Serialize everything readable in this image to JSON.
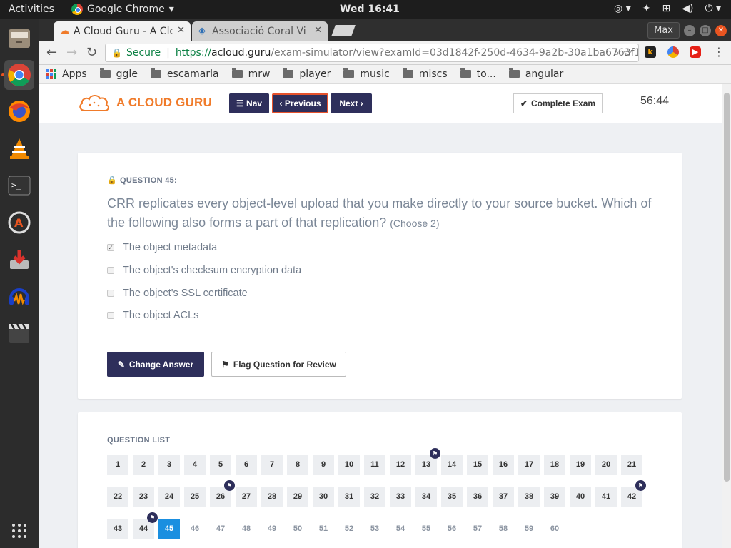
{
  "system": {
    "activities": "Activities",
    "app_name": "Google Chrome",
    "clock": "Wed 16:41"
  },
  "browser": {
    "tabs": [
      {
        "label": "A Cloud Guru - A Cloud Guru",
        "active": true
      },
      {
        "label": "Associació Coral Vi",
        "active": false
      }
    ],
    "window_label": "Max",
    "address": {
      "secure_label": "Secure",
      "scheme": "https://",
      "host": "acloud.guru",
      "path": "/exam-simulator/view?examId=03d1842f-250d-4634-9a2b-30a1ba6763f1..."
    },
    "bookmarks": [
      {
        "label": "Apps",
        "type": "apps"
      },
      {
        "label": "ggle",
        "type": "folder"
      },
      {
        "label": "escamarla",
        "type": "folder"
      },
      {
        "label": "mrw",
        "type": "folder"
      },
      {
        "label": "player",
        "type": "folder"
      },
      {
        "label": "music",
        "type": "folder"
      },
      {
        "label": "miscs",
        "type": "folder"
      },
      {
        "label": "to...",
        "type": "folder"
      },
      {
        "label": "angular",
        "type": "folder"
      }
    ]
  },
  "header": {
    "logo_text": "A CLOUD GURU",
    "nav_label": "Nav",
    "previous_label": "Previous",
    "next_label": "Next",
    "complete_label": "Complete Exam",
    "timer": "56:44"
  },
  "question": {
    "label": "QUESTION 45:",
    "text": "CRR replicates every object-level upload that you make directly to your source bucket. Which of the following also forms a part of that replication?",
    "choose": "(Choose 2)",
    "options": [
      {
        "label": "The object metadata",
        "checked": true
      },
      {
        "label": "The object's checksum encryption data",
        "checked": false
      },
      {
        "label": "The object's SSL certificate",
        "checked": false
      },
      {
        "label": "The object ACLs",
        "checked": false
      }
    ],
    "change_answer_label": "Change Answer",
    "flag_label": "Flag Question for Review"
  },
  "question_list": {
    "title": "QUESTION LIST",
    "total": 60,
    "current": 45,
    "answered_through": 44,
    "flagged": [
      13,
      26,
      42,
      44
    ]
  },
  "colors": {
    "brand_orange": "#f07b2a",
    "nav_button": "#2e2f5b",
    "current_question": "#1a8fe0",
    "accent_border": "#e6522c"
  }
}
